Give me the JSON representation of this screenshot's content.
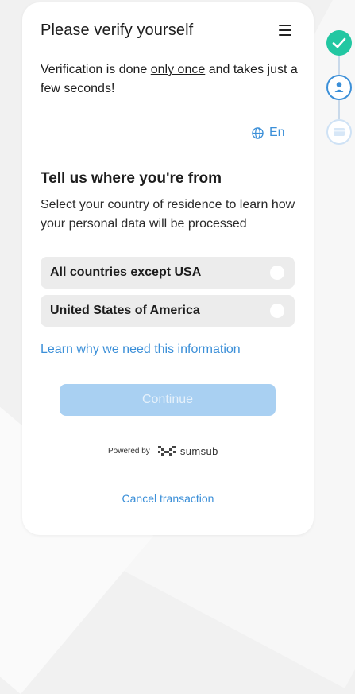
{
  "header": {
    "title": "Please verify yourself"
  },
  "intro": {
    "text_before": "Verification is done ",
    "text_underlined": "only once",
    "text_after": " and takes just a few seconds!"
  },
  "language": {
    "label": "En"
  },
  "country_section": {
    "title": "Tell us where you're from",
    "subtitle": "Select your country of residence to learn how your personal data will be processed",
    "options": [
      {
        "label": "All countries except USA",
        "selected": false
      },
      {
        "label": "United States of America",
        "selected": false
      }
    ],
    "learn_link": "Learn why we need this information"
  },
  "continue_button": {
    "label": "Continue",
    "enabled": false
  },
  "footer": {
    "powered_by": "Powered by",
    "brand": "sumsub",
    "cancel_link": "Cancel transaction"
  },
  "progress_steps": [
    {
      "icon": "check-icon",
      "state": "completed"
    },
    {
      "icon": "person-icon",
      "state": "current"
    },
    {
      "icon": "card-icon",
      "state": "upcoming"
    }
  ],
  "colors": {
    "accent": "#3b8fd8",
    "success": "#22c7a2",
    "button_disabled": "#a9d0f2",
    "option_bg": "#ececec"
  }
}
